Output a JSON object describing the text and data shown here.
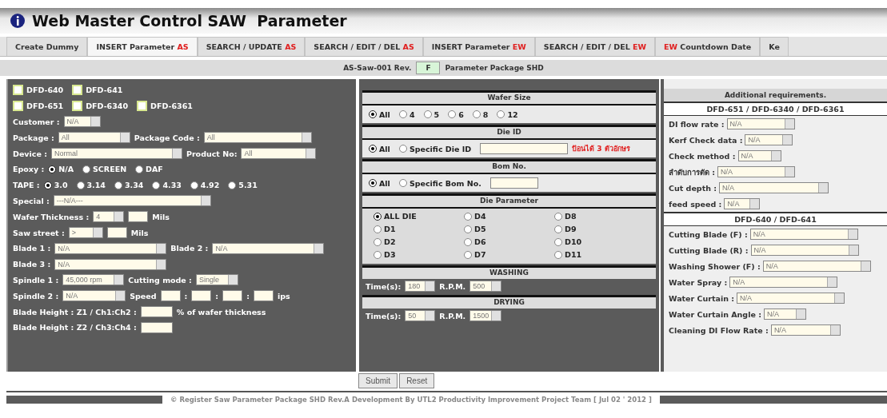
{
  "window": {
    "title": "Web Master Control SAW  Parameter"
  },
  "tabs": [
    {
      "parts": [
        {
          "kind": "plain",
          "text": "Create Dummy"
        }
      ],
      "selected": false
    },
    {
      "parts": [
        {
          "kind": "plain",
          "text": "INSERT Parameter"
        },
        {
          "kind": "tag",
          "text": "AS"
        }
      ],
      "selected": true
    },
    {
      "parts": [
        {
          "kind": "plain",
          "text": "SEARCH / UPDATE"
        },
        {
          "kind": "tag",
          "text": "AS"
        }
      ],
      "selected": false
    },
    {
      "parts": [
        {
          "kind": "plain",
          "text": "SEARCH / EDIT / DEL"
        },
        {
          "kind": "tag",
          "text": "AS"
        }
      ],
      "selected": false
    },
    {
      "parts": [
        {
          "kind": "plain",
          "text": "INSERT Parameter"
        },
        {
          "kind": "tag",
          "text": "EW"
        }
      ],
      "selected": false
    },
    {
      "parts": [
        {
          "kind": "plain",
          "text": "SEARCH / EDIT / DEL"
        },
        {
          "kind": "tag",
          "text": "EW"
        }
      ],
      "selected": false
    },
    {
      "parts": [
        {
          "kind": "tag",
          "text": "EW"
        },
        {
          "kind": "plain",
          "text": "Countdown Date"
        }
      ],
      "selected": false
    },
    {
      "parts": [
        {
          "kind": "plain",
          "text": "Ke"
        }
      ],
      "selected": false
    }
  ],
  "doc_header": {
    "prefix": "AS-Saw-001 Rev.",
    "revision": "F",
    "suffix": "Parameter Package SHD"
  },
  "models": [
    [
      {
        "label": "DFD-640",
        "checked": false
      },
      {
        "label": "DFD-641",
        "checked": false
      }
    ],
    [
      {
        "label": "DFD-651",
        "checked": false
      },
      {
        "label": "DFD-6340",
        "checked": false
      },
      {
        "label": "DFD-6361",
        "checked": false
      }
    ]
  ],
  "left_rows": [
    [
      {
        "kind": "label",
        "text": "Customer :"
      },
      {
        "kind": "select",
        "value": "N/A"
      }
    ],
    [
      {
        "kind": "label",
        "text": "Package :"
      },
      {
        "kind": "select",
        "value": "All"
      },
      {
        "kind": "label",
        "text": "Package Code :"
      },
      {
        "kind": "select",
        "value": "All"
      }
    ],
    [
      {
        "kind": "label",
        "text": "Device :"
      },
      {
        "kind": "select",
        "value": "Normal"
      },
      {
        "kind": "label",
        "text": "Product No:"
      },
      {
        "kind": "select",
        "value": "All"
      }
    ],
    [
      {
        "kind": "label",
        "text": "Epoxy :"
      },
      {
        "kind": "radio",
        "text": "N/A",
        "selected": true
      },
      {
        "kind": "radio",
        "text": "SCREEN",
        "selected": false
      },
      {
        "kind": "radio",
        "text": "DAF",
        "selected": false
      }
    ],
    [
      {
        "kind": "label",
        "text": "TAPE :"
      },
      {
        "kind": "radio",
        "text": "3.0",
        "selected": true
      },
      {
        "kind": "radio",
        "text": "3.14",
        "selected": false
      },
      {
        "kind": "radio",
        "text": "3.34",
        "selected": false
      },
      {
        "kind": "radio",
        "text": "4.33",
        "selected": false
      },
      {
        "kind": "radio",
        "text": "4.92",
        "selected": false
      },
      {
        "kind": "radio",
        "text": "5.31",
        "selected": false
      }
    ],
    [
      {
        "kind": "label",
        "text": "Special :"
      },
      {
        "kind": "select",
        "value": "---N/A---"
      }
    ],
    [
      {
        "kind": "label",
        "text": "Wafer Thickness :"
      },
      {
        "kind": "select",
        "value": "4"
      },
      {
        "kind": "input"
      },
      {
        "kind": "label",
        "text": "Mils"
      }
    ],
    [
      {
        "kind": "label",
        "text": "Saw street :"
      },
      {
        "kind": "select",
        "value": ">"
      },
      {
        "kind": "input"
      },
      {
        "kind": "label",
        "text": "Mils"
      }
    ],
    [
      {
        "kind": "label",
        "text": "Blade 1 :"
      },
      {
        "kind": "select",
        "value": "N/A"
      },
      {
        "kind": "label",
        "text": "Blade 2 :"
      },
      {
        "kind": "select",
        "value": "N/A"
      }
    ],
    [
      {
        "kind": "label",
        "text": "Blade 3 :"
      },
      {
        "kind": "select",
        "value": "N/A"
      }
    ],
    [
      {
        "kind": "label",
        "text": "Spindle 1 :"
      },
      {
        "kind": "select",
        "value": "45,000 rpm"
      },
      {
        "kind": "label",
        "text": "Cutting mode :"
      },
      {
        "kind": "select",
        "value": "Single"
      }
    ],
    [
      {
        "kind": "label",
        "text": "Spindle 2 :"
      },
      {
        "kind": "select",
        "value": "N/A"
      },
      {
        "kind": "label",
        "text": "Speed"
      },
      {
        "kind": "input"
      },
      {
        "kind": "label",
        "text": ":"
      },
      {
        "kind": "input"
      },
      {
        "kind": "label",
        "text": ":"
      },
      {
        "kind": "input"
      },
      {
        "kind": "label",
        "text": ":"
      },
      {
        "kind": "input"
      },
      {
        "kind": "label",
        "text": "ips"
      }
    ],
    [
      {
        "kind": "label",
        "text": "Blade Height : Z1 / Ch1:Ch2 :"
      },
      {
        "kind": "input"
      },
      {
        "kind": "label",
        "text": "% of wafer thickness"
      }
    ],
    [
      {
        "kind": "label",
        "text": "Blade Height : Z2 / Ch3:Ch4 :"
      },
      {
        "kind": "input"
      }
    ]
  ],
  "sections": [
    {
      "title": "Wafer Size",
      "kind": "choice",
      "items": [
        {
          "kind": "radio",
          "text": "All",
          "selected": true
        },
        {
          "kind": "radio",
          "text": "4",
          "selected": false
        },
        {
          "kind": "radio",
          "text": "5",
          "selected": false
        },
        {
          "kind": "radio",
          "text": "6",
          "selected": false
        },
        {
          "kind": "radio",
          "text": "8",
          "selected": false
        },
        {
          "kind": "radio",
          "text": "12",
          "selected": false
        }
      ]
    },
    {
      "title": "Die ID",
      "kind": "choice",
      "items": [
        {
          "kind": "radio",
          "text": "All",
          "selected": true
        },
        {
          "kind": "radio",
          "text": "Specific Die ID",
          "selected": false
        },
        {
          "kind": "input"
        },
        {
          "kind": "note",
          "text": "ป้อนได้ 3 ตัวอักษร"
        }
      ]
    },
    {
      "title": "Bom No.",
      "kind": "choice",
      "items": [
        {
          "kind": "radio",
          "text": "All",
          "selected": true
        },
        {
          "kind": "radio",
          "text": "Specific Bom No.",
          "selected": false
        },
        {
          "kind": "input"
        }
      ]
    },
    {
      "title": "Die Parameter",
      "kind": "grid",
      "items": [
        {
          "kind": "radio",
          "text": "ALL DIE",
          "selected": true
        },
        {
          "kind": "radio",
          "text": "D4",
          "selected": false
        },
        {
          "kind": "radio",
          "text": "D8",
          "selected": false
        },
        {
          "kind": "radio",
          "text": "D1",
          "selected": false
        },
        {
          "kind": "radio",
          "text": "D5",
          "selected": false
        },
        {
          "kind": "radio",
          "text": "D9",
          "selected": false
        },
        {
          "kind": "radio",
          "text": "D2",
          "selected": false
        },
        {
          "kind": "radio",
          "text": "D6",
          "selected": false
        },
        {
          "kind": "radio",
          "text": "D10",
          "selected": false
        },
        {
          "kind": "radio",
          "text": "D3",
          "selected": false
        },
        {
          "kind": "radio",
          "text": "D7",
          "selected": false
        },
        {
          "kind": "radio",
          "text": "D11",
          "selected": false
        }
      ]
    },
    {
      "title": "WASHING",
      "kind": "setting",
      "items": [
        {
          "kind": "label",
          "text": "Time(s):"
        },
        {
          "kind": "select",
          "value": "180"
        },
        {
          "kind": "label",
          "text": "R.P.M."
        },
        {
          "kind": "select",
          "value": "500"
        }
      ]
    },
    {
      "title": "DRYING",
      "kind": "setting",
      "items": [
        {
          "kind": "label",
          "text": "Time(s):"
        },
        {
          "kind": "select",
          "value": "50"
        },
        {
          "kind": "label",
          "text": "R.P.M."
        },
        {
          "kind": "select",
          "value": "1500"
        }
      ]
    }
  ],
  "additional": {
    "title": "Additional requirements.",
    "groups": [
      {
        "title": "DFD-651 / DFD-6340 / DFD-6361",
        "fields": [
          {
            "label": "DI flow rate :",
            "value": "N/A"
          },
          {
            "label": "Kerf Check data :",
            "value": "N/A"
          },
          {
            "label": "Check method :",
            "value": "N/A"
          },
          {
            "label": "ลำดับการตัด :",
            "value": "N/A"
          },
          {
            "label": "Cut depth :",
            "value": "N/A"
          },
          {
            "label": "feed speed :",
            "value": "N/A"
          }
        ]
      },
      {
        "title": "DFD-640 / DFD-641",
        "fields": [
          {
            "label": "Cutting Blade (F) :",
            "value": "N/A"
          },
          {
            "label": "Cutting Blade (R) :",
            "value": "N/A"
          },
          {
            "label": "Washing Shower (F) :",
            "value": "N/A"
          },
          {
            "label": "Water Spray :",
            "value": "N/A"
          },
          {
            "label": "Water Curtain :",
            "value": "N/A"
          },
          {
            "label": "Water Curtain Angle :",
            "value": "N/A"
          },
          {
            "label": "Cleaning DI Flow Rate :",
            "value": "N/A"
          }
        ]
      }
    ]
  },
  "buttons": [
    "Submit",
    "Reset"
  ],
  "footer": "© Register Saw Parameter Package SHD Rev.A Development By UTL2 Productivity Improvement Project Team [ Jul 02 ' 2012 ]"
}
